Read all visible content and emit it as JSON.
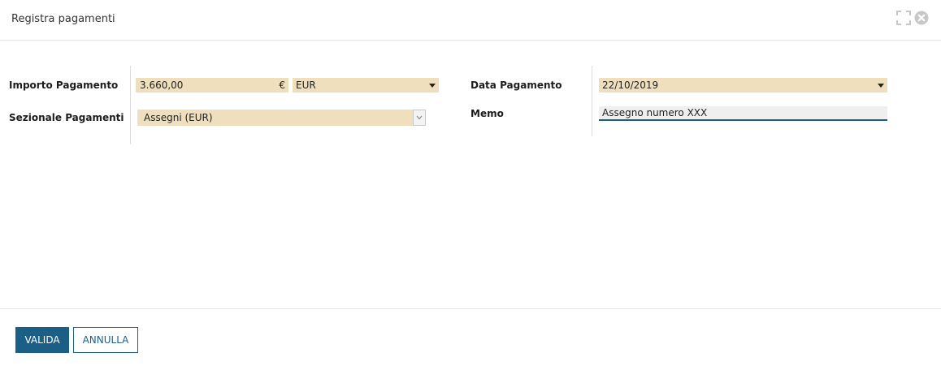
{
  "dialog": {
    "title": "Registra pagamenti"
  },
  "icons": {
    "expand": "expand-icon",
    "close": "close-circle-icon"
  },
  "form": {
    "amount": {
      "label": "Importo Pagamento",
      "value": "3.660,00",
      "currency_symbol": "€",
      "currency": "EUR"
    },
    "journal": {
      "label": "Sezionale Pagamenti",
      "value": "Assegni (EUR)"
    },
    "payment_date": {
      "label": "Data Pagamento",
      "value": "22/10/2019"
    },
    "memo": {
      "label": "Memo",
      "value": "Assegno numero XXX"
    }
  },
  "footer": {
    "confirm_label": "VALIDA",
    "cancel_label": "ANNULLA"
  },
  "colors": {
    "field_bg": "#f0dfbd",
    "primary": "#1b5f86"
  }
}
